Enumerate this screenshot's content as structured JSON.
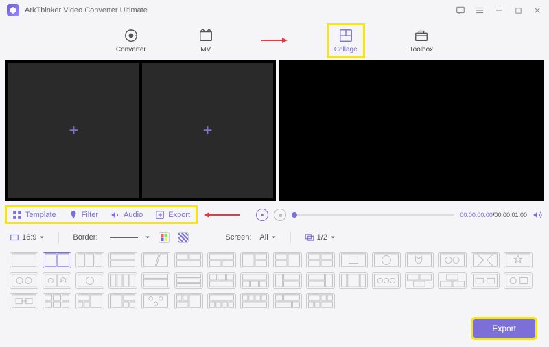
{
  "app": {
    "title": "ArkThinker Video Converter Ultimate"
  },
  "tabs": {
    "converter": "Converter",
    "mv": "MV",
    "collage": "Collage",
    "toolbox": "Toolbox"
  },
  "subtabs": {
    "template": "Template",
    "filter": "Filter",
    "audio": "Audio",
    "export": "Export"
  },
  "player": {
    "current": "00:00:00.00",
    "duration": "00:00:01.00"
  },
  "options": {
    "aspect": "16:9",
    "border_label": "Border:",
    "screen_label": "Screen:",
    "screen_value": "All",
    "page": "1/2"
  },
  "footer": {
    "export": "Export"
  }
}
